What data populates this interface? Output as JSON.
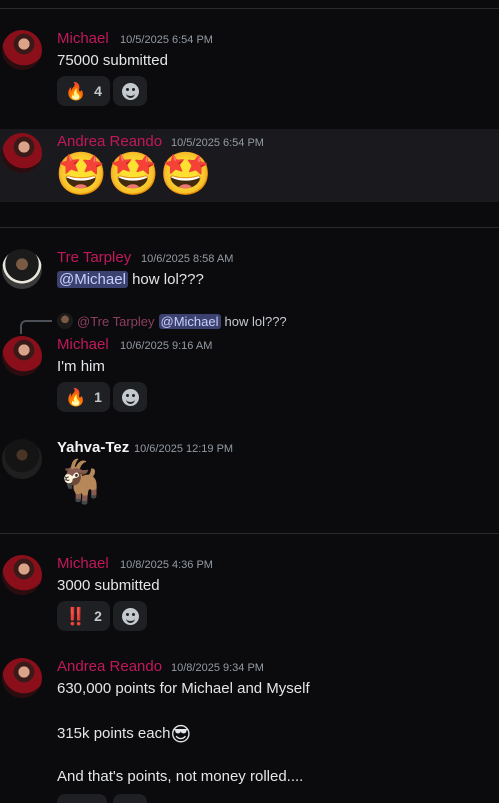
{
  "messages": [
    {
      "author": "Michael",
      "timestamp": "10/5/2025 6:54 PM",
      "text": "75000 submitted",
      "reactions": [
        {
          "emoji": "🔥",
          "count": "4"
        }
      ]
    },
    {
      "author": "Andrea Reando",
      "timestamp": "10/5/2025 6:54 PM",
      "emoji": "🤩🤩🤩"
    },
    {
      "author": "Tre Tarpley",
      "timestamp": "10/6/2025 8:58 AM",
      "mention": "@Michael",
      "text": " how lol???"
    },
    {
      "reply": {
        "author": "@Tre Tarpley",
        "mention": "@Michael",
        "text": "how lol???"
      },
      "author": "Michael",
      "timestamp": "10/6/2025 9:16 AM",
      "text": "I'm him",
      "reactions": [
        {
          "emoji": "🔥",
          "count": "1"
        }
      ]
    },
    {
      "author": "Yahva-Tez",
      "timestamp": "10/6/2025 12:19 PM",
      "emoji": "🐐"
    },
    {
      "author": "Michael",
      "timestamp": "10/8/2025 4:36 PM",
      "text": "3000 submitted",
      "reactions": [
        {
          "emoji": "‼️",
          "count": "2"
        }
      ]
    },
    {
      "author": "Andrea Reando",
      "timestamp": "10/8/2025 9:34 PM",
      "lines": [
        "630,000 points for Michael and Myself",
        "315k points each",
        "And that's points, not money rolled...."
      ],
      "inline_emoji": "😎"
    }
  ],
  "colors": {
    "accent_name": "#c2185b",
    "mention_bg": "#3c4270",
    "background": "#0b0b0d"
  }
}
